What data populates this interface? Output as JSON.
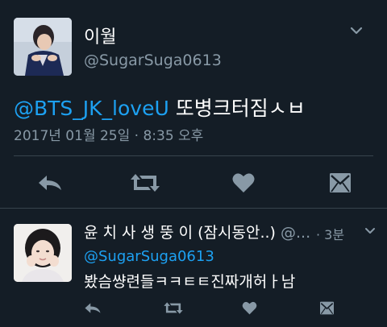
{
  "main_tweet": {
    "display_name": "이월",
    "handle": "@SugarSuga0613",
    "mention": "@BTS_JK_loveU",
    "text": " 또병크터짐ㅅㅂ",
    "timestamp": "2017년 01월 25일 · 8:35 오후",
    "icons": [
      "reply-icon",
      "retweet-icon",
      "like-icon",
      "direct-message-icon",
      "chevron-down-icon"
    ]
  },
  "reply_tweet": {
    "display_name": "윤 치 사 생 뚱 이 (잠시동안..)",
    "handle_truncated": "@...",
    "time_ago": "· 3분",
    "mention": "@SugarSuga0613",
    "text": "봤슴썅련들ㅋㅋㅌㅌ진짜개허ㅏ남",
    "icons": [
      "reply-icon",
      "retweet-icon",
      "like-icon",
      "direct-message-icon",
      "chevron-down-icon"
    ]
  },
  "colors": {
    "background": "#141d26",
    "text_primary": "#ffffff",
    "text_secondary": "#8899a6",
    "link": "#1da1f2",
    "divider": "#38444d"
  }
}
